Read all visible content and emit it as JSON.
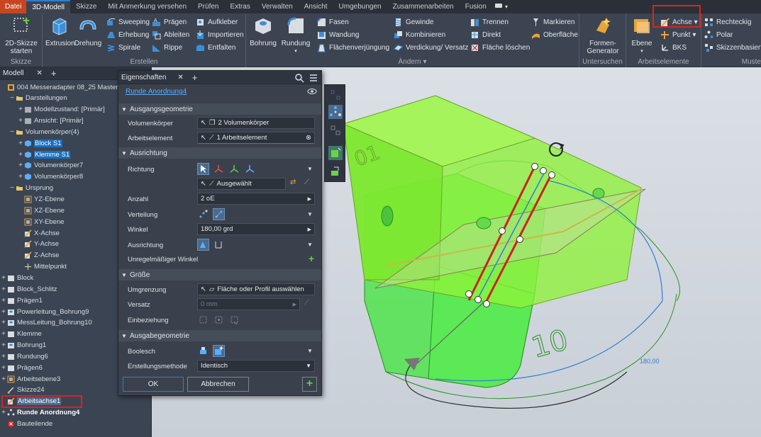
{
  "menubar": {
    "items": [
      "Datei",
      "3D-Modell",
      "Skizze",
      "Mit Anmerkung versehen",
      "Prüfen",
      "Extras",
      "Verwalten",
      "Ansicht",
      "Umgebungen",
      "Zusammenarbeiten",
      "Fusion"
    ],
    "active_index": 1,
    "extra": "▾"
  },
  "ribbon": {
    "skizze": {
      "group_label": "Skizze",
      "sketch_button": "2D-Skizze starten"
    },
    "erstellen": {
      "group_label": "Erstellen",
      "extrusion": "Extrusion",
      "drehung": "Drehung",
      "sweeping": "Sweeping",
      "erhebung": "Erhebung",
      "spirale": "Spirale",
      "praegen": "Prägen",
      "ableiten": "Ableiten",
      "rippe": "Rippe",
      "aufkleber": "Aufkleber",
      "importieren": "Importieren",
      "entfalten": "Entfalten"
    },
    "aendern": {
      "group_label": "Ändern",
      "bohrung": "Bohrung",
      "rundung": "Rundung",
      "fasen": "Fasen",
      "wandung": "Wandung",
      "flaechenverjuengung": "Flächenverjüngung",
      "gewinde": "Gewinde",
      "kombinieren": "Kombinieren",
      "verdickung": "Verdickung/ Versatz",
      "trennen": "Trennen",
      "direkt": "Direkt",
      "flaeche_loeschen": "Fläche löschen",
      "markieren": "Markieren",
      "oberflaeche": "Oberfläche"
    },
    "untersuchen": {
      "group_label": "Untersuchen",
      "formen_generator": "Formen-Generator"
    },
    "arbeitselemente": {
      "group_label": "Arbeitselemente",
      "ebene": "Ebene",
      "achse": "Achse",
      "punkt": "Punkt",
      "bks": "BKS"
    },
    "muster": {
      "group_label": "Muste",
      "rechteckig": "Rechteckig",
      "polar": "Polar",
      "skizzenbasiert": "Skizzenbasiert"
    }
  },
  "browser": {
    "tab_label": "Modell",
    "rows": [
      {
        "label": "004 Messeradapter 08_25 Master.ipt",
        "indent": 0,
        "toggle": "",
        "icon": "part"
      },
      {
        "label": "Darstellungen",
        "indent": 1,
        "toggle": "−",
        "icon": "folder"
      },
      {
        "label": "Modellzustand: [Primär]",
        "indent": 2,
        "toggle": "+",
        "icon": "model-state"
      },
      {
        "label": "Ansicht: [Primär]",
        "indent": 2,
        "toggle": "+",
        "icon": "view"
      },
      {
        "label": "Volumenkörper(4)",
        "indent": 1,
        "toggle": "−",
        "icon": "folder"
      },
      {
        "label": "Block S1",
        "indent": 2,
        "toggle": "+",
        "icon": "body",
        "style": "sel"
      },
      {
        "label": "Klemme S1",
        "indent": 2,
        "toggle": "+",
        "icon": "body",
        "style": "sel"
      },
      {
        "label": "Volumenkörper7",
        "indent": 2,
        "toggle": "+",
        "icon": "body"
      },
      {
        "label": "Volumenkörper8",
        "indent": 2,
        "toggle": "+",
        "icon": "body"
      },
      {
        "label": "Ursprung",
        "indent": 1,
        "toggle": "−",
        "icon": "folder"
      },
      {
        "label": "YZ-Ebene",
        "indent": 2,
        "toggle": "",
        "icon": "plane"
      },
      {
        "label": "XZ-Ebene",
        "indent": 2,
        "toggle": "",
        "icon": "plane"
      },
      {
        "label": "XY-Ebene",
        "indent": 2,
        "toggle": "",
        "icon": "plane"
      },
      {
        "label": "X-Achse",
        "indent": 2,
        "toggle": "",
        "icon": "axis"
      },
      {
        "label": "Y-Achse",
        "indent": 2,
        "toggle": "",
        "icon": "axis"
      },
      {
        "label": "Z-Achse",
        "indent": 2,
        "toggle": "",
        "icon": "axis"
      },
      {
        "label": "Mittelpunkt",
        "indent": 2,
        "toggle": "",
        "icon": "point"
      },
      {
        "label": "Block",
        "indent": 0,
        "toggle": "+",
        "icon": "feature"
      },
      {
        "label": "Block_Schlitz",
        "indent": 0,
        "toggle": "+",
        "icon": "feature"
      },
      {
        "label": "Prägen1",
        "indent": 0,
        "toggle": "+",
        "icon": "emboss"
      },
      {
        "label": "Powerleitung_Bohrung9",
        "indent": 0,
        "toggle": "+",
        "icon": "hole"
      },
      {
        "label": "MessLeitung_Bohrung10",
        "indent": 0,
        "toggle": "+",
        "icon": "hole"
      },
      {
        "label": "Klemme",
        "indent": 0,
        "toggle": "+",
        "icon": "feature"
      },
      {
        "label": "Bohrung1",
        "indent": 0,
        "toggle": "+",
        "icon": "hole"
      },
      {
        "label": "Rundung6",
        "indent": 0,
        "toggle": "+",
        "icon": "fillet"
      },
      {
        "label": "Prägen6",
        "indent": 0,
        "toggle": "+",
        "icon": "emboss"
      },
      {
        "label": "Arbeitsebene3",
        "indent": 0,
        "toggle": "+",
        "icon": "workplane"
      },
      {
        "label": "Skizze24",
        "indent": 0,
        "toggle": "",
        "icon": "sketch"
      },
      {
        "label": "Arbeitsachse1",
        "indent": 0,
        "toggle": "",
        "icon": "workaxis",
        "style": "hl"
      },
      {
        "label": "Runde Anordnung4",
        "indent": 0,
        "toggle": "+",
        "icon": "pattern",
        "style": "bold"
      },
      {
        "label": "Bauteilende",
        "indent": 0,
        "toggle": "",
        "icon": "end"
      }
    ]
  },
  "properties": {
    "tab_label": "Eigenschaften",
    "feature_name": "Runde Anordnung4",
    "sections": {
      "ausgangsgeometrie": "Ausgangsgeometrie",
      "ausrichtung": "Ausrichtung",
      "groesse": "Größe",
      "ausgabegeometrie": "Ausgabegeometrie"
    },
    "labels": {
      "volumenkoerper": "Volumenkörper",
      "arbeitselement": "Arbeitselement",
      "richtung": "Richtung",
      "anzahl": "Anzahl",
      "verteilung": "Verteilung",
      "winkel": "Winkel",
      "ausrichtung": "Ausrichtung",
      "unregelmaessig": "Unregelmäßiger Winkel",
      "umgrenzung": "Umgrenzung",
      "versatz": "Versatz",
      "einbeziehung": "Einbeziehung",
      "boolesch": "Boolesch",
      "erstellungsmethode": "Erstellungsmethode"
    },
    "values": {
      "volumenkoerper": "2 Volumenkörper",
      "arbeitselement": "1 Arbeitselement",
      "richtung": "Ausgewählt",
      "anzahl": "2 oE",
      "winkel": "180,00 grd",
      "umgrenzung": "Fläche oder Profil auswählen",
      "versatz": "0 mm",
      "erstellungsmethode": "Identisch"
    },
    "buttons": {
      "ok": "OK",
      "cancel": "Abbrechen",
      "add": "+"
    }
  },
  "viewport": {
    "angle_label": "180,00",
    "colors": {
      "body": "#39e600",
      "edge": "#cc2222",
      "axis": "#2f7fd8"
    }
  }
}
